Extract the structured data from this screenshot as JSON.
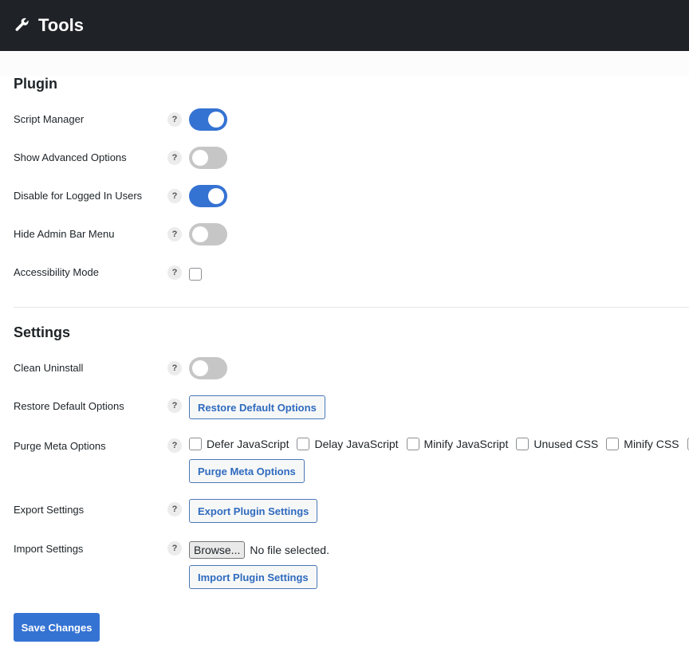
{
  "header": {
    "icon": "wrench-icon",
    "title": "Tools"
  },
  "plugin_section": {
    "heading": "Plugin",
    "rows": [
      {
        "label": "Script Manager",
        "control": "toggle",
        "value": true
      },
      {
        "label": "Show Advanced Options",
        "control": "toggle",
        "value": false
      },
      {
        "label": "Disable for Logged In Users",
        "control": "toggle",
        "value": true
      },
      {
        "label": "Hide Admin Bar Menu",
        "control": "toggle",
        "value": false
      },
      {
        "label": "Accessibility Mode",
        "control": "checkbox",
        "value": false
      }
    ]
  },
  "settings_section": {
    "heading": "Settings",
    "clean_uninstall": {
      "label": "Clean Uninstall",
      "value": false
    },
    "restore_defaults": {
      "label": "Restore Default Options",
      "button": "Restore Default Options"
    },
    "purge_meta": {
      "label": "Purge Meta Options",
      "options": [
        {
          "label": "Defer JavaScript",
          "checked": false
        },
        {
          "label": "Delay JavaScript",
          "checked": false
        },
        {
          "label": "Minify JavaScript",
          "checked": false
        },
        {
          "label": "Unused CSS",
          "checked": false
        },
        {
          "label": "Minify CSS",
          "checked": false
        }
      ],
      "button": "Purge Meta Options"
    },
    "export": {
      "label": "Export Settings",
      "button": "Export Plugin Settings"
    },
    "import": {
      "label": "Import Settings",
      "browse_button": "Browse...",
      "file_status": "No file selected.",
      "button": "Import Plugin Settings"
    }
  },
  "help_glyph": "?",
  "save_button": "Save Changes",
  "colors": {
    "header_bg": "#1f2226",
    "accent": "#3573d3",
    "toggle_off": "#c6c6c6"
  }
}
